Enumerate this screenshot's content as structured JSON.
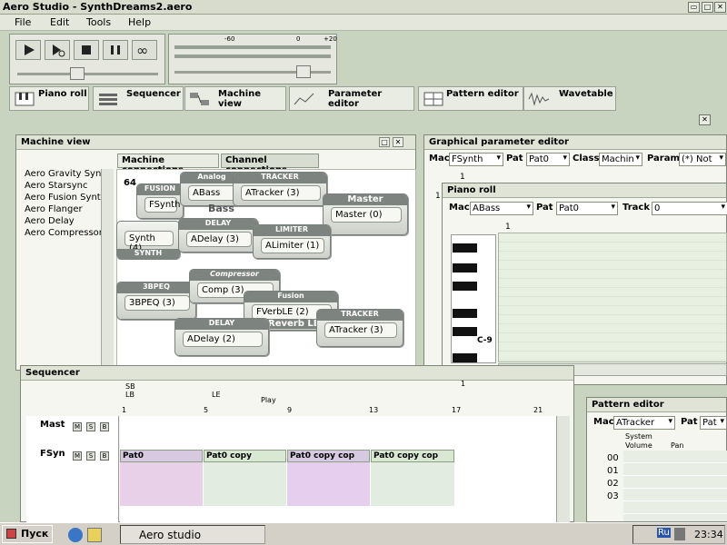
{
  "app": {
    "title": "Aero Studio - SynthDreams2.aero"
  },
  "menu": [
    "File",
    "Edit",
    "Tools",
    "Help"
  ],
  "transport": {
    "level_ticks": [
      "-60",
      "0",
      "+20"
    ]
  },
  "tabs": [
    "Piano roll",
    "Sequencer",
    "Machine view",
    "Parameter editor",
    "Pattern editor",
    "Wavetable"
  ],
  "machine_view": {
    "title": "Machine view",
    "tab_connections": "Machine connections",
    "tab_channels": "Channel connections",
    "list": [
      "Aero Gravity Synth",
      "Aero Starsync",
      "Aero Fusion Synth",
      "Aero Flanger",
      "Aero Delay",
      "Aero Compressor"
    ],
    "label_64": "64",
    "nodes": [
      {
        "title": "FUSION",
        "text": "FSynth"
      },
      {
        "title": "Analog",
        "text": "ABass"
      },
      {
        "title": "Bass",
        "text": ""
      },
      {
        "title": "TRACKER",
        "text": "ATracker (3)"
      },
      {
        "title": "Master",
        "text": "Master (0)"
      },
      {
        "title": "SYNTH",
        "text": "Synth (4)"
      },
      {
        "title": "DELAY",
        "text": "ADelay (3)"
      },
      {
        "title": "LIMITER",
        "text": "ALimiter (1)"
      },
      {
        "title": "3BPEQ",
        "text": "3BPEQ (3)"
      },
      {
        "title": "Compressor",
        "text": "Comp (3)"
      },
      {
        "title": "Fusion",
        "text": "FVerbLE (2)"
      },
      {
        "title": "Reverb LE",
        "text": ""
      },
      {
        "title": "DELAY",
        "text": "ADelay (2)"
      },
      {
        "title": "TRACKER",
        "text": "ATracker (3)"
      }
    ]
  },
  "param_editor": {
    "title": "Graphical parameter editor",
    "mac_label": "Mac",
    "mac_value": "FSynth",
    "pat_label": "Pat",
    "pat_value": "Pat0",
    "class_label": "Class",
    "class_value": "Machin",
    "param_label": "Param",
    "param_value": "(*) Not",
    "ruler": "1",
    "row": "1"
  },
  "piano_roll": {
    "title": "Piano roll",
    "mac_label": "Mac",
    "mac_value": "ABass",
    "pat_label": "Pat",
    "pat_value": "Pat0",
    "track_label": "Track",
    "track_value": "0",
    "ruler": "1",
    "note_label": "C-9"
  },
  "sequencer": {
    "title": "Sequencer",
    "markers": [
      "SB",
      "LB",
      "LE",
      "Play"
    ],
    "ruler": [
      "1",
      "5",
      "9",
      "13",
      "17",
      "21"
    ],
    "tracks": [
      {
        "name": "Mast",
        "btns": [
          "M",
          "S",
          "B"
        ]
      },
      {
        "name": "FSyn",
        "btns": [
          "M",
          "S",
          "B"
        ]
      }
    ],
    "patterns": [
      "Pat0",
      "Pat0 copy",
      "Pat0 copy cop",
      "Pat0 copy cop"
    ],
    "partial": "1"
  },
  "pattern_editor": {
    "title": "Pattern editor",
    "mac_label": "Mac",
    "mac_value": "ATracker",
    "pat_label": "Pat",
    "pat_value": "Pat",
    "system": "System",
    "col_volume": "Volume",
    "col_pan": "Pan",
    "rows": [
      "00",
      "01",
      "02",
      "03"
    ]
  },
  "taskbar": {
    "start": "Пуск",
    "task": "Aero studio",
    "lang": "Ru",
    "time": "23:34"
  },
  "colors": {
    "bg": "#c8d4c0",
    "pattern_pink": "#e8d0e8",
    "pattern_green": "#dcebd5"
  }
}
